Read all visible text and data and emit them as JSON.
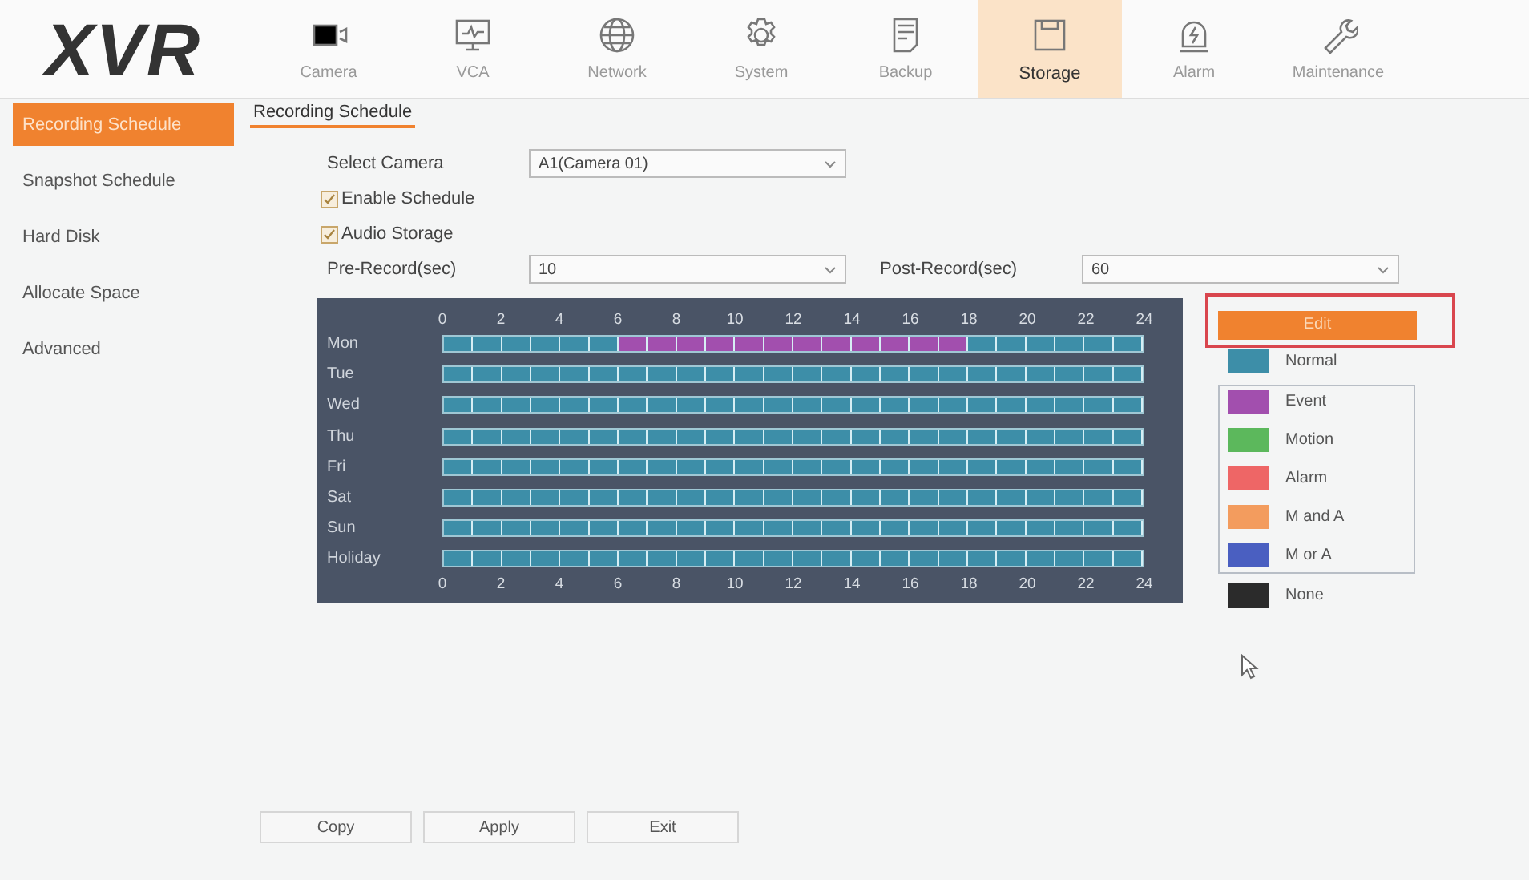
{
  "logo": "XVR",
  "nav": [
    {
      "label": "Camera",
      "selected": false
    },
    {
      "label": "VCA",
      "selected": false
    },
    {
      "label": "Network",
      "selected": false
    },
    {
      "label": "System",
      "selected": false
    },
    {
      "label": "Backup",
      "selected": false
    },
    {
      "label": "Storage",
      "selected": true
    },
    {
      "label": "Alarm",
      "selected": false
    },
    {
      "label": "Maintenance",
      "selected": false
    }
  ],
  "sidebar": [
    {
      "label": "Recording Schedule",
      "selected": true
    },
    {
      "label": "Snapshot Schedule",
      "selected": false
    },
    {
      "label": "Hard Disk",
      "selected": false
    },
    {
      "label": "Allocate Space",
      "selected": false
    },
    {
      "label": "Advanced",
      "selected": false
    }
  ],
  "tabs": [
    {
      "label": "Recording Schedule",
      "selected": true
    }
  ],
  "form": {
    "select_camera": {
      "label": "Select Camera",
      "value": "A1(Camera 01)"
    },
    "enable_schedule": {
      "label": "Enable Schedule",
      "checked": true
    },
    "audio_storage": {
      "label": "Audio Storage",
      "checked": true
    },
    "pre_record": {
      "label": "Pre-Record(sec)",
      "value": "10"
    },
    "post_record": {
      "label": "Post-Record(sec)",
      "value": "60"
    }
  },
  "schedule": {
    "top_hour_labels": [
      "0",
      "2",
      "4",
      "6",
      "8",
      "10",
      "12",
      "14",
      "16",
      "18",
      "20",
      "22",
      "24"
    ],
    "bottom_hour_labels": [
      "0",
      "2",
      "4",
      "6",
      "8",
      "10",
      "12",
      "14",
      "16",
      "18",
      "20",
      "22",
      "24"
    ],
    "days": [
      {
        "label": "Mon",
        "segments": [
          {
            "level": 0.25,
            "color": "#3d8ea8"
          },
          {
            "level": 0.5,
            "color": "#a24fae"
          },
          {
            "level": 0.25,
            "color": "#3d8ea8"
          }
        ]
      },
      {
        "label": "Tue",
        "segments": [
          {
            "level": 1,
            "color": "#3d8ea8"
          }
        ]
      },
      {
        "label": "Wed",
        "segments": [
          {
            "level": 1,
            "color": "#3d8ea8"
          }
        ]
      },
      {
        "label": "Thu",
        "segments": [
          {
            "level": 1,
            "color": "#3d8ea8"
          }
        ]
      },
      {
        "label": "Fri",
        "segments": [
          {
            "level": 1,
            "color": "#3d8ea8"
          }
        ]
      },
      {
        "label": "Sat",
        "segments": [
          {
            "level": 1,
            "color": "#3d8ea8"
          }
        ]
      },
      {
        "label": "Sun",
        "segments": [
          {
            "level": 1,
            "color": "#3d8ea8"
          }
        ]
      },
      {
        "label": "Holiday",
        "segments": [
          {
            "level": 1,
            "color": "#3d8ea8"
          }
        ]
      }
    ]
  },
  "edit_button": {
    "label": "Edit",
    "highlighted": true
  },
  "legend": [
    {
      "label": "Normal",
      "color": "#3d8ea8",
      "grouped": false
    },
    {
      "label": "Event",
      "color": "#a24fae",
      "grouped": true
    },
    {
      "label": "Motion",
      "color": "#5cb85c",
      "grouped": true
    },
    {
      "label": "Alarm",
      "color": "#ee6666",
      "grouped": true
    },
    {
      "label": "M and A",
      "color": "#f39c5e",
      "grouped": true
    },
    {
      "label": "M or A",
      "color": "#4a5fc1",
      "grouped": true
    },
    {
      "label": "None",
      "color": "#2b2b2b",
      "grouped": false
    }
  ],
  "buttons": [
    "Copy",
    "Apply",
    "Exit"
  ]
}
